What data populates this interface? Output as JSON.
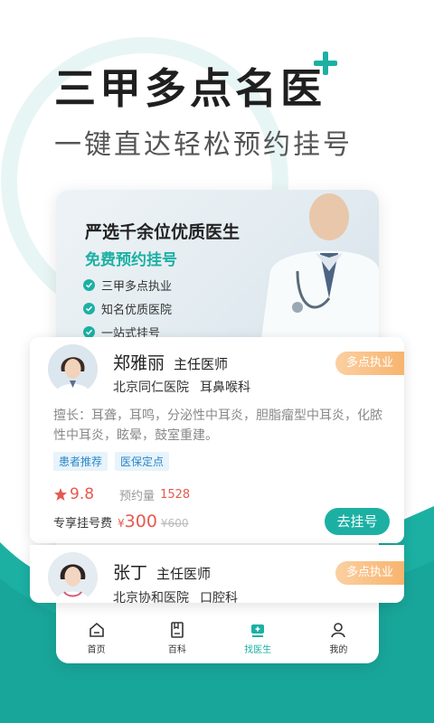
{
  "headline": {
    "title": "三甲多点名医",
    "subtitle": "一键直达轻松预约挂号"
  },
  "banner": {
    "heading": "严选千余位优质医生",
    "subheading": "免费预约挂号",
    "features": [
      "三甲多点执业",
      "知名优质医院",
      "一站式挂号"
    ]
  },
  "doctors": [
    {
      "name": "郑雅丽",
      "title": "主任医师",
      "hospital": "北京同仁医院",
      "department": "耳鼻喉科",
      "badge": "多点执业",
      "description": "擅长：耳聋，耳鸣，分泌性中耳炎，胆脂瘤型中耳炎，化脓性中耳炎，眩晕，鼓室重建。",
      "tags": [
        "患者推荐",
        "医保定点"
      ],
      "rating": "9.8",
      "booked_label": "预约量",
      "booked_count": "1528",
      "price_label": "专享挂号费",
      "currency": "¥",
      "price": "300",
      "original_price": "¥600",
      "book_button": "去挂号"
    },
    {
      "name": "张丁",
      "title": "主任医师",
      "hospital": "北京协和医院",
      "department": "口腔科",
      "badge": "多点执业"
    }
  ],
  "tabbar": {
    "items": [
      {
        "label": "首页",
        "icon": "home-icon"
      },
      {
        "label": "百科",
        "icon": "encyclopedia-icon"
      },
      {
        "label": "找医生",
        "icon": "find-doctor-icon"
      },
      {
        "label": "我的",
        "icon": "profile-icon"
      }
    ],
    "active_index": 2
  },
  "colors": {
    "accent": "#1cb0a3",
    "price": "#e6594f",
    "badge": "#f7b46e",
    "tag_text": "#2a87c8"
  }
}
